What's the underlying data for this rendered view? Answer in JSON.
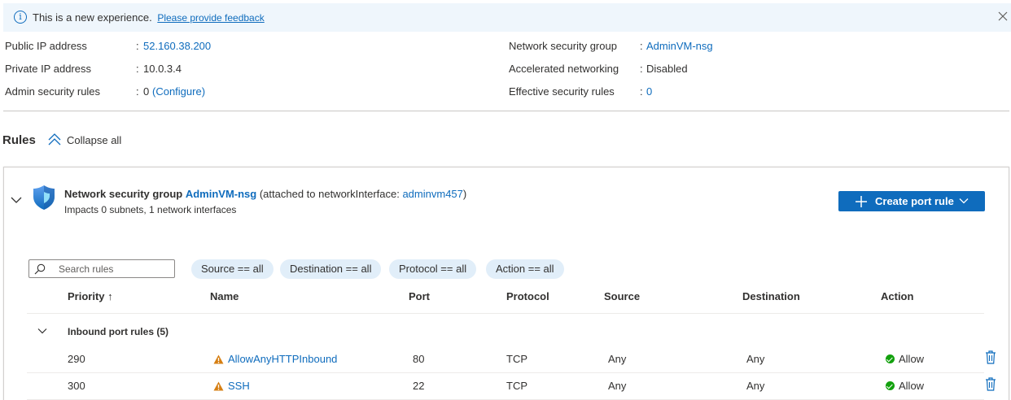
{
  "banner": {
    "message": "This is a new experience.",
    "feedback_link": "Please provide feedback"
  },
  "properties": {
    "public_ip": {
      "label": "Public IP address",
      "value": "52.160.38.200"
    },
    "private_ip": {
      "label": "Private IP address",
      "value": "10.0.3.4"
    },
    "admin_rules": {
      "label": "Admin security rules",
      "value": "0",
      "action": "(Configure)"
    },
    "nsg": {
      "label": "Network security group",
      "value": "AdminVM-nsg"
    },
    "accel": {
      "label": "Accelerated networking",
      "value": "Disabled"
    },
    "effective": {
      "label": "Effective security rules",
      "value": "0"
    },
    "separator": ":"
  },
  "rules": {
    "title": "Rules",
    "collapse_all": "Collapse all"
  },
  "nsg_card": {
    "prefix": "Network security group",
    "name": "AdminVM-nsg",
    "attached_text_pre": "(attached to networkInterface:",
    "interface": "adminvm457",
    "attached_text_post": ")",
    "subtitle": "Impacts 0 subnets, 1 network interfaces",
    "create_button": "Create port rule"
  },
  "filters": {
    "search_placeholder": "Search rules",
    "pills": [
      "Source == all",
      "Destination == all",
      "Protocol == all",
      "Action == all"
    ]
  },
  "table": {
    "columns": [
      "Priority ↑",
      "Name",
      "Port",
      "Protocol",
      "Source",
      "Destination",
      "Action"
    ],
    "group_label": "Inbound port rules (5)",
    "rows": [
      {
        "priority": "290",
        "name": "AllowAnyHTTPInbound",
        "port": "80",
        "protocol": "TCP",
        "source": "Any",
        "destination": "Any",
        "action": "Allow"
      },
      {
        "priority": "300",
        "name": "SSH",
        "port": "22",
        "protocol": "TCP",
        "source": "Any",
        "destination": "Any",
        "action": "Allow"
      }
    ]
  },
  "colors": {
    "accent": "#0f6cbd",
    "banner_bg": "#eff6fc",
    "pill_bg": "#e1eef9",
    "allow_green": "#13a10e",
    "warning_orange": "#d67f13"
  }
}
